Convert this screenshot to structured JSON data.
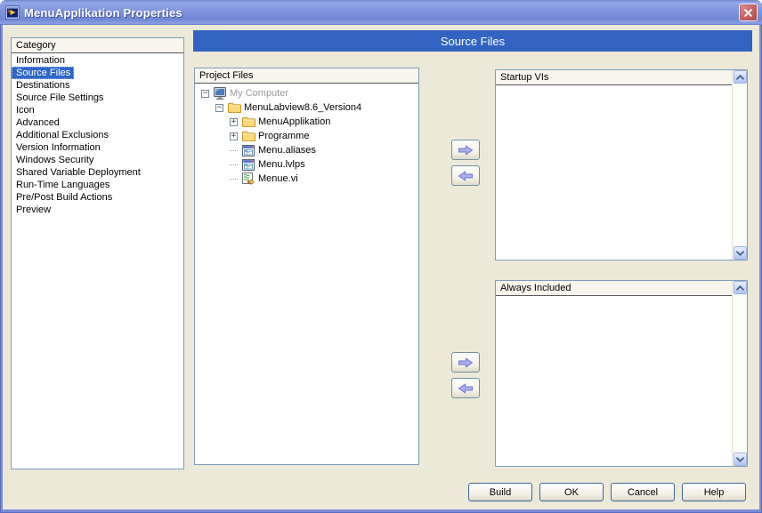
{
  "window": {
    "title": "MenuApplikation Properties"
  },
  "page_header": {
    "title": "Source Files"
  },
  "category_panel": {
    "header": "Category",
    "selected_index": 1,
    "items": [
      "Information",
      "Source Files",
      "Destinations",
      "Source File Settings",
      "Icon",
      "Advanced",
      "Additional Exclusions",
      "Version Information",
      "Windows Security",
      "Shared Variable Deployment",
      "Run-Time Languages",
      "Pre/Post Build Actions",
      "Preview"
    ]
  },
  "project_files_panel": {
    "header": "Project Files",
    "tree": [
      {
        "label": "My Computer",
        "level": 0,
        "icon": "computer-icon",
        "expander": "minus",
        "dimmed": true
      },
      {
        "label": "MenuLabview8.6_Version4",
        "level": 1,
        "icon": "folder-icon",
        "expander": "minus",
        "dimmed": false
      },
      {
        "label": "MenuApplikation",
        "level": 2,
        "icon": "folder-icon",
        "expander": "plus",
        "dimmed": false
      },
      {
        "label": "Programme",
        "level": 2,
        "icon": "folder-icon",
        "expander": "plus",
        "dimmed": false
      },
      {
        "label": "Menu.aliases",
        "level": 2,
        "icon": "lvfile-icon",
        "expander": "none",
        "dimmed": false
      },
      {
        "label": "Menu.lvlps",
        "level": 2,
        "icon": "lvfile-icon",
        "expander": "none",
        "dimmed": false
      },
      {
        "label": "Menue.vi",
        "level": 2,
        "icon": "vi-icon",
        "expander": "none",
        "dimmed": false
      }
    ]
  },
  "startup_panel": {
    "header": "Startup VIs"
  },
  "always_panel": {
    "header": "Always Included"
  },
  "transfer": {
    "add_icon": "arrow-right-icon",
    "remove_icon": "arrow-left-icon"
  },
  "scrollbar": {
    "up_icon": "chevron-up-icon",
    "down_icon": "chevron-down-icon"
  },
  "titlebar_icons": {
    "app_icon": "labview-app-icon",
    "close_icon": "close-icon"
  },
  "footer": {
    "buttons": [
      {
        "label": "Build",
        "name": "build-button"
      },
      {
        "label": "OK",
        "name": "ok-button"
      },
      {
        "label": "Cancel",
        "name": "cancel-button"
      },
      {
        "label": "Help",
        "name": "help-button"
      }
    ]
  },
  "colors": {
    "dialog_bg": "#ECE9D8",
    "titlebar_blue": "#7E94DE",
    "section_header_blue": "#3164C2",
    "selection_blue": "#2F66C8",
    "panel_border": "#7F9DB9"
  }
}
